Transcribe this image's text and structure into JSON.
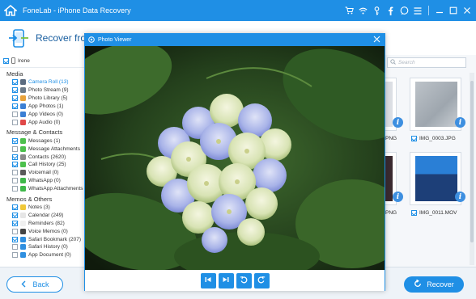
{
  "app": {
    "title": "FoneLab - iPhone Data Recovery"
  },
  "header": {
    "title": "Recover from"
  },
  "device": {
    "name": "Irene"
  },
  "groups": [
    {
      "title": "Media",
      "items": [
        {
          "label": "Camera Roll (13)",
          "checked": true,
          "selected": true,
          "color": "#5a6b80"
        },
        {
          "label": "Photo Stream (9)",
          "checked": true,
          "color": "#6a7a8a"
        },
        {
          "label": "Photo Library (5)",
          "checked": true,
          "color": "#e8a23a"
        },
        {
          "label": "App Photos (1)",
          "checked": true,
          "color": "#3b7fd4"
        },
        {
          "label": "App Videos (0)",
          "checked": false,
          "color": "#3b7fd4"
        },
        {
          "label": "App Audio (0)",
          "checked": false,
          "color": "#e04848"
        }
      ]
    },
    {
      "title": "Message & Contacts",
      "items": [
        {
          "label": "Messages (1)",
          "checked": true,
          "color": "#4cc04c"
        },
        {
          "label": "Message Attachments",
          "checked": false,
          "color": "#4cc04c"
        },
        {
          "label": "Contacts (2620)",
          "checked": true,
          "color": "#8a8a8a"
        },
        {
          "label": "Call History (25)",
          "checked": true,
          "color": "#4cc04c"
        },
        {
          "label": "Voicemail (0)",
          "checked": false,
          "color": "#5a5a5a"
        },
        {
          "label": "WhatsApp (0)",
          "checked": false,
          "color": "#3fb84a"
        },
        {
          "label": "WhatsApp Attachments",
          "checked": false,
          "color": "#3fb84a"
        }
      ]
    },
    {
      "title": "Memos & Others",
      "items": [
        {
          "label": "Notes (3)",
          "checked": true,
          "color": "#f0c838"
        },
        {
          "label": "Calendar (249)",
          "checked": true,
          "color": "#e6e6e6"
        },
        {
          "label": "Reminders (82)",
          "checked": true,
          "color": "#f0f0f0"
        },
        {
          "label": "Voice Memos (0)",
          "checked": false,
          "color": "#444444"
        },
        {
          "label": "Safari Bookmark (207)",
          "checked": true,
          "color": "#2f8fe0"
        },
        {
          "label": "Safari History (0)",
          "checked": false,
          "color": "#2f8fe0"
        },
        {
          "label": "App Document (0)",
          "checked": false,
          "color": "#2f8fe0"
        }
      ]
    }
  ],
  "search": {
    "placeholder": "Search"
  },
  "files": [
    {
      "label": "PNG",
      "checked": false
    },
    {
      "label": "IMG_0003.JPG",
      "checked": true
    },
    {
      "label": "PNG",
      "checked": false
    },
    {
      "label": "IMG_0011.MOV",
      "checked": true
    }
  ],
  "viewer": {
    "title": "Photo Viewer"
  },
  "footer": {
    "back_label": "Back",
    "recover_label": "Recover"
  },
  "colors": {
    "accent": "#1f8fe5",
    "header_text": "#1a5fa0"
  }
}
